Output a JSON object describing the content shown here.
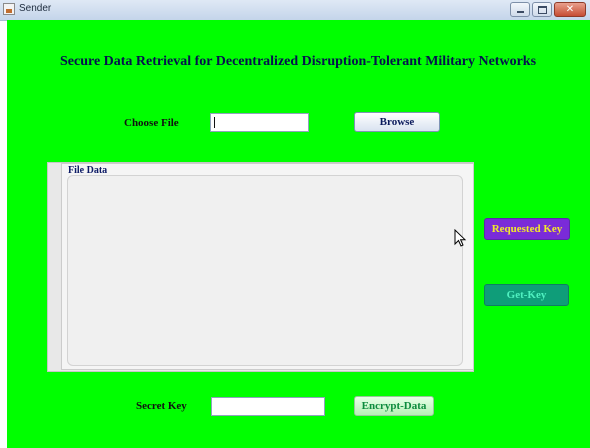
{
  "window": {
    "title": "Sender",
    "close_glyph": "✕"
  },
  "heading": "Secure Data Retrieval for Decentralized Disruption-Tolerant Military Networks",
  "choose_file": {
    "label": "Choose File",
    "value": "",
    "browse_label": "Browse"
  },
  "file_data": {
    "title": "File Data",
    "content": ""
  },
  "buttons": {
    "requested_key": "Requested Key",
    "get_key": "Get-Key",
    "encrypt_data": "Encrypt-Data"
  },
  "secret_key": {
    "label": "Secret Key",
    "value": ""
  },
  "colors": {
    "background": "#00ff00",
    "requested_key_bg": "#7a2bd8",
    "requested_key_text": "#f2ea2a",
    "get_key_bg": "#0f9d79",
    "get_key_text": "#50f0c0",
    "heading_text": "#05124e"
  },
  "icons": [
    "app-icon",
    "minimize-icon",
    "maximize-icon",
    "close-icon",
    "mouse-cursor-icon"
  ]
}
